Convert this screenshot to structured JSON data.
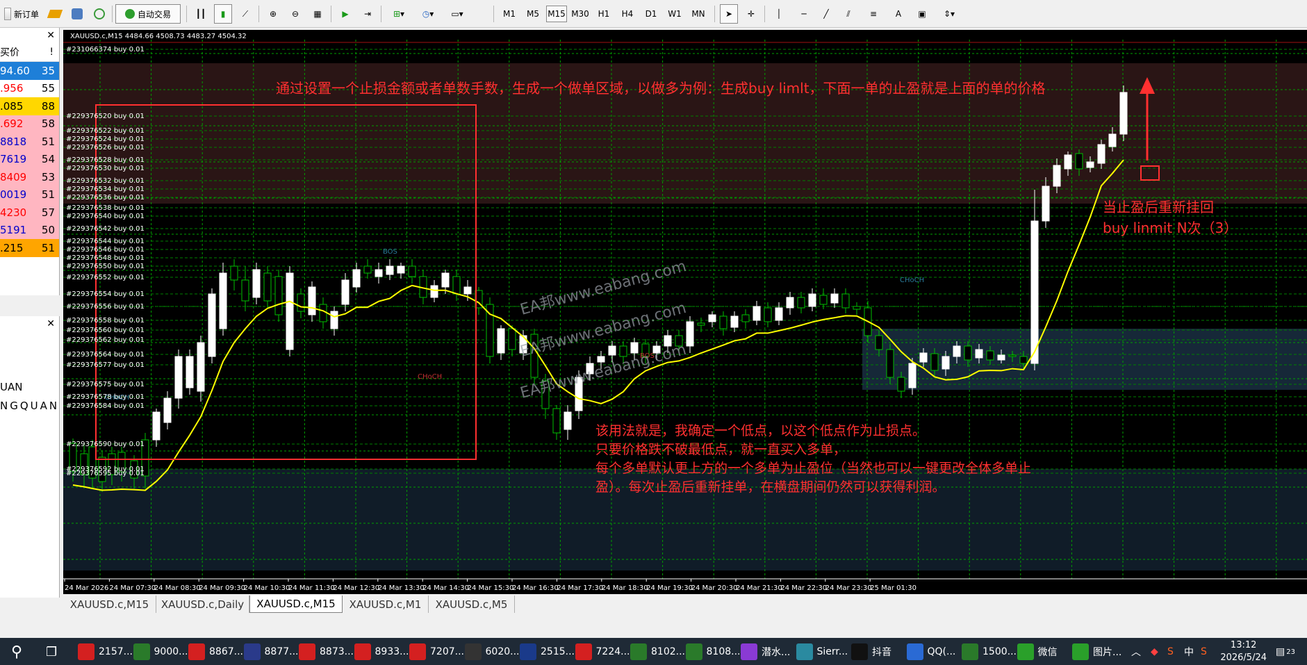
{
  "toolbar": {
    "new_order": "新订单",
    "auto_trading": "自动交易",
    "timeframes": [
      "M1",
      "M5",
      "M15",
      "M30",
      "H1",
      "H4",
      "D1",
      "W1",
      "MN"
    ],
    "active_timeframe": "M15",
    "text_tool": "A"
  },
  "market_watch": {
    "col_bid": "买价",
    "col_spread": "!",
    "rows": [
      {
        "price": "94.60",
        "spread": "35",
        "bg": "#1e7fd8",
        "fg": "#ffffff"
      },
      {
        "price": ".956",
        "spread": "55",
        "bg": "#ffffff",
        "fg": "#ff0000"
      },
      {
        "price": ".085",
        "spread": "88",
        "bg": "#ffd700",
        "fg": "#000000"
      },
      {
        "price": ".692",
        "spread": "58",
        "bg": "#ffb6c1",
        "fg": "#ff0000"
      },
      {
        "price": "8818",
        "spread": "51",
        "bg": "#ffb6c1",
        "fg": "#0000cc"
      },
      {
        "price": "7619",
        "spread": "54",
        "bg": "#ffb6c1",
        "fg": "#0000cc"
      },
      {
        "price": "8409",
        "spread": "53",
        "bg": "#ffb6c1",
        "fg": "#ff0000"
      },
      {
        "price": "0019",
        "spread": "51",
        "bg": "#ffb6c1",
        "fg": "#0000cc"
      },
      {
        "price": "4230",
        "spread": "57",
        "bg": "#ffb6c1",
        "fg": "#ff0000"
      },
      {
        "price": "5191",
        "spread": "50",
        "bg": "#ffb6c1",
        "fg": "#0000cc"
      },
      {
        "price": ".215",
        "spread": "51",
        "bg": "#ffa500",
        "fg": "#000000"
      }
    ]
  },
  "navigator": {
    "line1": "UAN",
    "line2": "NGQUAN"
  },
  "chart": {
    "header": "XAUUSD.c,M15  4484.66 4508.73 4483.27 4504.32",
    "top_order": "#231066374 buy 0.01",
    "orders": [
      "#229376520 buy 0.01",
      "#229376522 buy 0.01",
      "#229376524 buy 0.01",
      "#229376526 buy 0.01",
      "#229376528 buy 0.01",
      "#229376530 buy 0.01",
      "#229376532 buy 0.01",
      "#229376534 buy 0.01",
      "#229376536 buy 0.01",
      "#229376538 buy 0.01",
      "#229376540 buy 0.01",
      "#229376542 buy 0.01",
      "#229376544 buy 0.01",
      "#229376546 buy 0.01",
      "#229376548 buy 0.01",
      "#229376550 buy 0.01",
      "#229376552 buy 0.01",
      "#229376554 buy 0.01",
      "#229376556 buy 0.01",
      "#229376558 buy 0.01",
      "#229376560 buy 0.01",
      "#229376562 buy 0.01",
      "#229376564 buy 0.01",
      "#229376577 buy 0.01",
      "#229376575 buy 0.01",
      "#229376578 buy 0.01",
      "#229376584 buy 0.01",
      "#229376590 buy 0.01",
      "#229376592 buy 0.01",
      "#229376595 buy 0.01"
    ],
    "time_labels": [
      "24 Mar 2026",
      "24 Mar 07:30",
      "24 Mar 08:30",
      "24 Mar 09:30",
      "24 Mar 10:30",
      "24 Mar 11:30",
      "24 Mar 12:30",
      "24 Mar 13:30",
      "24 Mar 14:30",
      "24 Mar 15:30",
      "24 Mar 16:30",
      "24 Mar 17:30",
      "24 Mar 18:30",
      "24 Mar 19:30",
      "24 Mar 20:30",
      "24 Mar 21:30",
      "24 Mar 22:30",
      "24 Mar 23:30",
      "25 Mar 01:30"
    ],
    "annotation_top": "通过设置一个止损金额或者单数手数，生成一个做单区域，以做多为例：生成buy limlt，下面一单的止盈就是上面的单的价格",
    "annotation_right_1": "当止盈后重新挂回",
    "annotation_right_2": "buy linmit N次（3）",
    "annotation_bottom": [
      "该用法就是，我确定一个低点，以这个低点作为止损点。",
      "只要价格跌不破最低点，就一直买入多单，",
      "每个多单默认更上方的一个多单为止盈位（当然也可以一键更改全体多单止",
      "盈）。每次止盈后重新挂单，在横盘期间仍然可以获得利润。"
    ],
    "watermark": "EA邦www.eabang.com",
    "labels": {
      "bos": "BOS",
      "choch": "CHoCH"
    },
    "colors": {
      "bull": "#ffffff",
      "bear": "#00c000",
      "ma": "#ffff00",
      "annotation": "#ff3030",
      "grid": "#00a000"
    }
  },
  "tabs": [
    "XAUUSD.c,M15",
    "XAUUSD.c,Daily",
    "XAUUSD.c,M15",
    "XAUUSD.c,M1",
    "XAUUSD.c,M5"
  ],
  "active_tab_index": 2,
  "taskbar": {
    "items": [
      "2157...",
      "9000...",
      "8867...",
      "8877...",
      "8873...",
      "8933...",
      "7207...",
      "6020...",
      "2515...",
      "7224...",
      "8102...",
      "8108...",
      "潜水...",
      "Sierr...",
      "抖音",
      "QQ(...",
      "1500...",
      "微信",
      "图片..."
    ],
    "ime": "中",
    "time": "13:12",
    "date": "2026/5/24",
    "notify_count": "23"
  }
}
